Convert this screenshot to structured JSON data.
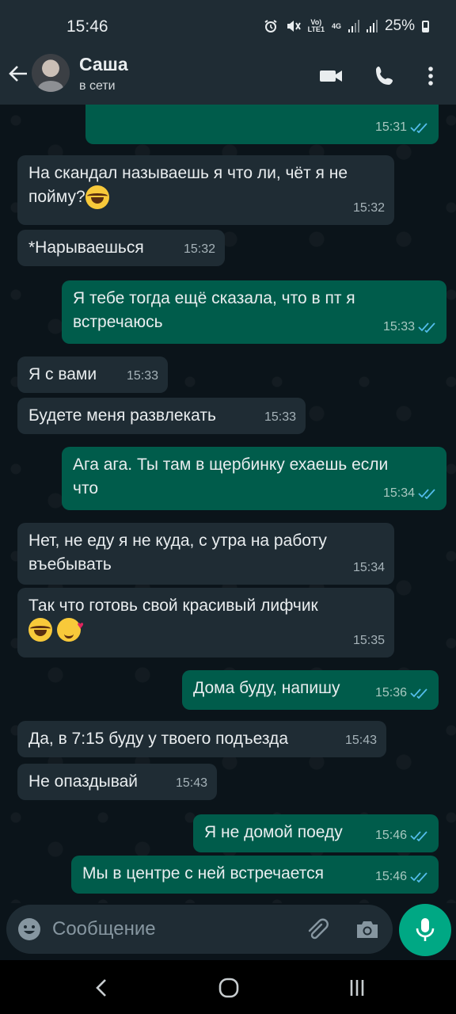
{
  "status_bar": {
    "time": "15:46",
    "network_volte": "Vo)",
    "network_lte": "LTE1",
    "network_4g": "4G",
    "battery_percent": "25%"
  },
  "header": {
    "contact_name": "Саша",
    "contact_status": "в сети",
    "icons": [
      "back-arrow-icon",
      "video-call-icon",
      "phone-icon",
      "more-vertical-icon"
    ]
  },
  "messages": [
    {
      "dir": "out",
      "text": "",
      "time": "15:31",
      "read": true
    },
    {
      "dir": "in",
      "text": "На скандал называешь я что ли, чёт я не пойму?",
      "emoji": [
        "laugh"
      ],
      "time": "15:32"
    },
    {
      "dir": "in",
      "text": "*Нарываешься",
      "time": "15:32"
    },
    {
      "dir": "out",
      "text": "Я тебе тогда ещё сказала, что в пт я встречаюсь",
      "time": "15:33",
      "read": true
    },
    {
      "dir": "in",
      "text": "Я с вами",
      "time": "15:33"
    },
    {
      "dir": "in",
      "text": "Будете меня развлекать",
      "time": "15:33"
    },
    {
      "dir": "out",
      "text": "Ага ага. Ты там в щербинку ехаешь если что",
      "time": "15:34",
      "read": true
    },
    {
      "dir": "in",
      "text": "Нет, не еду я не куда, с утра на работу въебывать",
      "time": "15:34"
    },
    {
      "dir": "in",
      "text": "Так что готовь свой красивый лифчик",
      "emoji": [
        "laugh",
        "love"
      ],
      "time": "15:35"
    },
    {
      "dir": "out",
      "text": "Дома буду, напишу",
      "time": "15:36",
      "read": true
    },
    {
      "dir": "in",
      "text": "Да, в 7:15 буду у твоего подъезда",
      "time": "15:43"
    },
    {
      "dir": "in",
      "text": "Не опаздывай",
      "time": "15:43"
    },
    {
      "dir": "out",
      "text": "Я не домой поеду",
      "time": "15:46",
      "read": true
    },
    {
      "dir": "out",
      "text": "Мы в центре с ней встречается",
      "time": "15:46",
      "read": true
    }
  ],
  "composer": {
    "placeholder": "Сообщение",
    "icons": [
      "emoji-icon",
      "attach-icon",
      "camera-icon",
      "mic-icon"
    ]
  },
  "colors": {
    "chat_bg": "#0b141a",
    "bar_bg": "#1f2c34",
    "incoming": "#1f2c34",
    "outgoing": "#005c4b",
    "accent": "#00a884",
    "read_ticks": "#53bdeb"
  }
}
